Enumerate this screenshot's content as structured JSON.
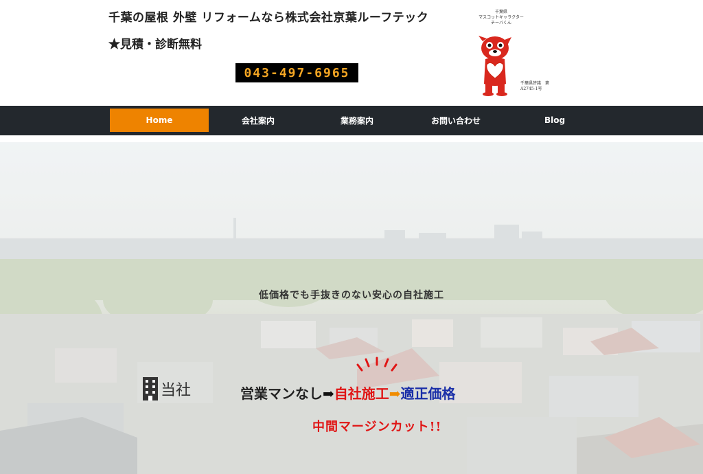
{
  "header": {
    "title": "千葉の屋根 外壁 リフォームなら株式会社京葉ルーフテック",
    "subtitle": "★見積・診断無料",
    "phone": "043-497-6965",
    "mascot_caption": [
      "千葉県",
      "マスコットキャラクター",
      "チーバくん"
    ],
    "license": [
      "千葉県許諾　第",
      "A2745-1号"
    ]
  },
  "nav": {
    "items": [
      {
        "label": "Home",
        "active": true
      },
      {
        "label": "会社案内",
        "active": false
      },
      {
        "label": "業務案内",
        "active": false
      },
      {
        "label": "お問い合わせ",
        "active": false
      },
      {
        "label": "Blog",
        "active": false
      }
    ]
  },
  "hero": {
    "tagline": "低価格でも手抜きのない安心の自社施工",
    "tosha": "当社",
    "slogan": {
      "part1": "営業マンなし",
      "arrow1": "➡",
      "part2": "自社施工",
      "arrow2": "➡",
      "part3": "適正価格"
    },
    "margin_cut": "中間マージンカット!!"
  },
  "colors": {
    "nav_bg": "#23282d",
    "nav_active": "#ee8300",
    "phone_text": "#f5a623",
    "red": "#e01515",
    "blue": "#1a2fa8"
  }
}
